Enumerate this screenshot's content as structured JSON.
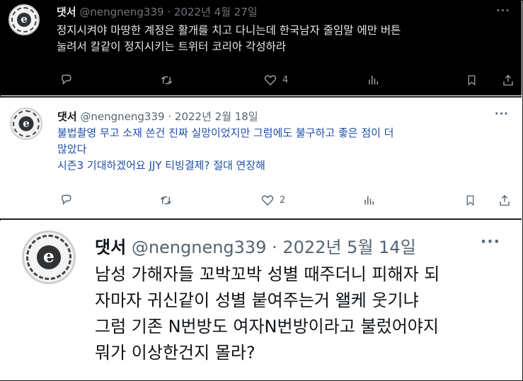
{
  "tweets": [
    {
      "name": "댓서",
      "handle": "@nengneng339",
      "separator": "·",
      "date": "2022년 4월 27일",
      "more": "···",
      "lines": [
        "정지시켜야 마땅한 계정은 활개를 치고 다니는데 한국남자 줄임말 에만 버튼",
        "눌려서 칼같이 정지시키는 트위터 코리아 각성하라"
      ],
      "actions": {
        "reply_count": "",
        "retweet_count": "",
        "like_count": "4",
        "views_count": ""
      }
    },
    {
      "name": "댓서",
      "handle": "@nengneng339",
      "separator": "·",
      "date": "2022년 2월 18일",
      "more": "···",
      "lines": [
        "불법촬영 무고 소재 쓴건 진짜 실망이었지만 그럼에도 불구하고 좋은 점이 더",
        "많았다",
        "시즌3 기대하겠어요 JJY 티빙결제? 절대 연장해"
      ],
      "actions": {
        "reply_count": "",
        "retweet_count": "",
        "like_count": "2",
        "views_count": ""
      }
    },
    {
      "name": "댓서",
      "handle": "@nengneng339",
      "separator": "·",
      "date": "2022년 5월 14일",
      "more": "···",
      "lines": [
        "남성 가해자들 꼬박꼬박 성별 때주더니 피해자 되",
        "자마자 귀신같이 성별 붙여주는거 왤케 웃기냐",
        "그럼 기존 N번방도 여자N번방이라고 불렀어야지",
        "뭐가 이상한건지 몰라?"
      ]
    }
  ],
  "avatar_letter": "e",
  "icons": [
    "reply-icon",
    "retweet-icon",
    "like-icon",
    "views-icon",
    "bookmark-icon",
    "share-icon"
  ],
  "colors": {
    "dark_bg": "#000000",
    "dark_text": "#e7e9ea",
    "light_text": "#0f1419",
    "muted": "#536471"
  }
}
